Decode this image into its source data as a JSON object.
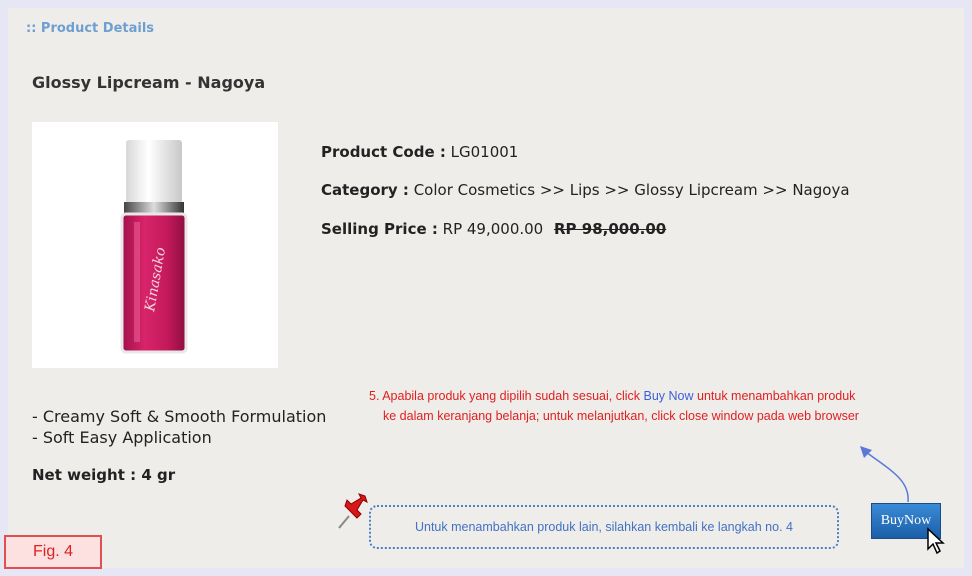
{
  "section_title": ":: Product Details",
  "product": {
    "name": "Glossy Lipcream - Nagoya",
    "code_label": "Product Code :",
    "code_value": "LG01001",
    "category_label": "Category :",
    "category_value": "Color Cosmetics >> Lips >> Glossy Lipcream >> Nagoya",
    "price_label": "Selling Price :",
    "price_value": "RP 49,000.00",
    "price_old": "RP 98,000.00",
    "features": [
      "- Creamy Soft & Smooth Formulation",
      "- Soft Easy Application"
    ],
    "net_label": "Net weight :",
    "net_value": "4 gr",
    "bottle_brand": "Kinasako"
  },
  "notes": {
    "step5_a": "5. Apabila produk yang dipilih sudah sesuai, click ",
    "step5_link": "Buy Now",
    "step5_b": " untuk menambahkan produk",
    "step5_line2": "ke dalam keranjang belanja; untuk melanjutkan, click close window pada web browser",
    "other": "Untuk menambahkan produk lain, silahkan kembali ke langkah no. 4"
  },
  "buy_button": "BuyNow",
  "figure_label": "Fig. 4",
  "colors": {
    "accent_title": "#6f9fd1",
    "note_red": "#e02020",
    "note_blue": "#4470c4",
    "button": "#1b5fa8"
  }
}
